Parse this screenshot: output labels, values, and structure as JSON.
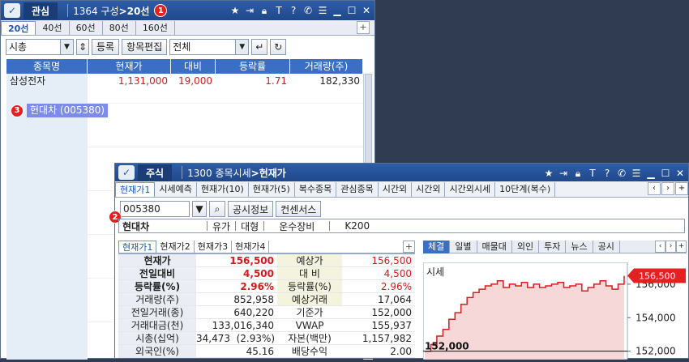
{
  "watch": {
    "tag": "관심",
    "screen_code": "1364",
    "screen_name": "구성",
    "arrow": ">",
    "group": "20선",
    "badge": "1",
    "tabs": [
      "20선",
      "40선",
      "60선",
      "80선",
      "160선"
    ],
    "tab_plus": "+",
    "sort_value": "시총",
    "btn_register": "등록",
    "btn_edit": "항목편집",
    "filter_value": "전체",
    "columns": [
      "종목명",
      "현재가",
      "대비",
      "등락률",
      "거래량(주)"
    ],
    "rows": [
      {
        "name": "삼성전자",
        "price": "1,131,000",
        "change": "19,000",
        "rate": "1.71",
        "volume": "182,330"
      }
    ],
    "selected_badge": "3",
    "selected_item": "현대차 (005380)"
  },
  "stock": {
    "tag": "주식",
    "screen_code": "1300",
    "screen_name": "종목시세",
    "arrow": ">",
    "current": "현재가",
    "badge": "2",
    "tabs": [
      "현재가1",
      "시세예측",
      "현재가(10)",
      "현재가(5)",
      "복수종목",
      "관심종목",
      "시간외",
      "시간외",
      "시간외시세",
      "10단계(복수)"
    ],
    "code": "005380",
    "btn_disclosure": "공시정보",
    "btn_consensus": "컨센서스",
    "info": {
      "name": "현대차",
      "f1": "유가",
      "f2": "대형",
      "f3": "운수장비",
      "f4": "K200"
    },
    "subtabs": [
      "현재가1",
      "현재가2",
      "현재가3",
      "현재가4"
    ],
    "quote_rows": [
      {
        "k1": "현재가",
        "v1": "156,500",
        "k2": "예상가",
        "v2": "156,500"
      },
      {
        "k1": "전일대비",
        "v1": "4,500",
        "k2": "대 비",
        "v2": "4,500"
      },
      {
        "k1": "등락률(%)",
        "v1": "2.96%",
        "k2": "등락률(%)",
        "v2": "2.96%"
      },
      {
        "k1": "거래량(주)",
        "v1": "852,958",
        "k2": "예상거래",
        "v2": "17,064"
      },
      {
        "k1": "전일거래(종)",
        "v1": "640,220",
        "k2": "기준가",
        "v2": "152,000"
      },
      {
        "k1": "거래대금(천)",
        "v1": "133,016,340",
        "k2": "VWAP",
        "v2": "155,937"
      },
      {
        "k1": "시총(십억)",
        "v1": "34,473  (2.93%)",
        "k2": "자본(백만)",
        "v2": "1,157,982"
      },
      {
        "k1": "외국인(%)",
        "v1": "45.16",
        "k2": "배당수익",
        "v2": "2.00"
      }
    ],
    "chart_tabs": [
      "체결",
      "일별",
      "매물대",
      "외인",
      "투자",
      "뉴스",
      "공시"
    ],
    "chart_label": "시세",
    "chart_last_label": "156,500",
    "chart_low_label": "152,000"
  },
  "chart_data": {
    "type": "line",
    "title": "시세",
    "ylim": [
      151500,
      157300
    ],
    "yticks": [
      "156,000",
      "154,000",
      "152,000"
    ],
    "series": [
      {
        "values": [
          152000,
          152400,
          152900,
          153300,
          153900,
          154300,
          154800,
          155200,
          155500,
          155700,
          155900,
          156000,
          156200,
          155800,
          156000,
          155900,
          156100,
          155800,
          156000,
          155800,
          155900,
          156000,
          156100,
          155800,
          155900,
          156000,
          155600,
          155800,
          156000,
          156200,
          155900,
          155700,
          156000,
          156500
        ]
      }
    ],
    "colors": {
      "line": "#d42020",
      "fill": "#f7d8d8"
    }
  }
}
